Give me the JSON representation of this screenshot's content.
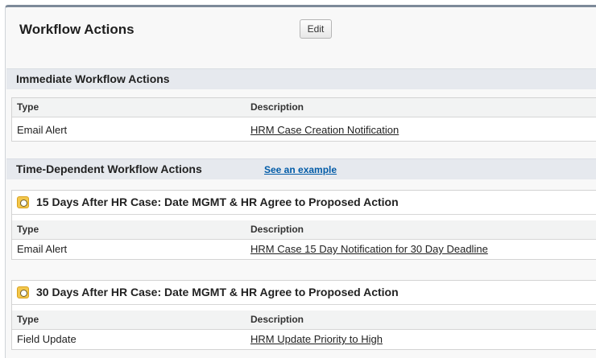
{
  "header": {
    "title": "Workflow Actions",
    "edit_label": "Edit"
  },
  "immediate": {
    "title": "Immediate Workflow Actions",
    "columns": [
      "Type",
      "Description"
    ],
    "rows": [
      {
        "type": "Email Alert",
        "description": "HRM Case Creation Notification"
      }
    ]
  },
  "time_dependent": {
    "title": "Time-Dependent Workflow Actions",
    "example_link": "See an example",
    "groups": [
      {
        "trigger": "15 Days After HR Case: Date MGMT & HR Agree to Proposed Action",
        "columns": [
          "Type",
          "Description"
        ],
        "rows": [
          {
            "type": "Email Alert",
            "description": "HRM Case 15 Day Notification for 30 Day Deadline"
          }
        ]
      },
      {
        "trigger": "30 Days After HR Case: Date MGMT & HR Agree to Proposed Action",
        "columns": [
          "Type",
          "Description"
        ],
        "rows": [
          {
            "type": "Field Update",
            "description": "HRM Update Priority to High"
          }
        ]
      }
    ]
  },
  "colors": {
    "link": "#015ba7",
    "section_bar": "#e6e9ee",
    "header_border": "#7d8a99",
    "icon": "#f3c74c"
  },
  "icons": [
    "clock-icon"
  ]
}
